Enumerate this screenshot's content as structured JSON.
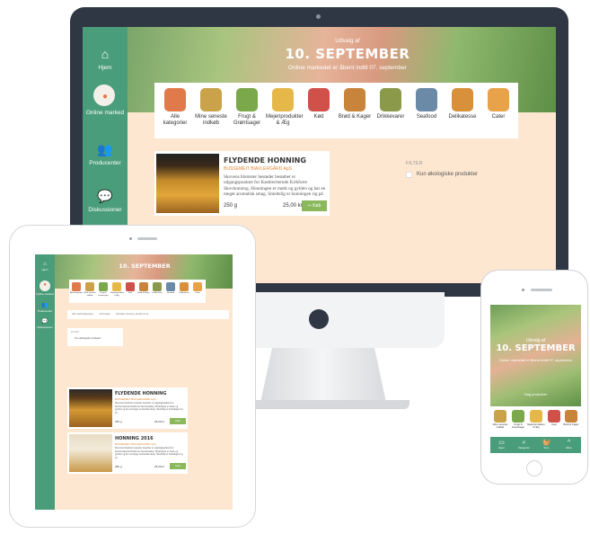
{
  "sidebar": [
    {
      "label": "Hjem",
      "icon": "home-icon",
      "glyph": "⌂"
    },
    {
      "label": "Online marked",
      "icon": "market-icon",
      "glyph": "●"
    },
    {
      "label": "Producenter",
      "icon": "people-icon",
      "glyph": "👥"
    },
    {
      "label": "Diskussioner",
      "icon": "chat-icon",
      "glyph": "💬"
    }
  ],
  "hero": {
    "subtitle": "Udvalg af",
    "date": "10. SEPTEMBER",
    "description": "Online markedet er åbent indtil 07. september"
  },
  "categories": [
    {
      "label": "Alle kategorier",
      "color": "#e07a4a"
    },
    {
      "label": "Mine seneste indkøb",
      "color": "#c9a24a"
    },
    {
      "label": "Frugt & Grøntsager",
      "color": "#7aa84a"
    },
    {
      "label": "Mejeriprodukter & Æg",
      "color": "#e6b84a"
    },
    {
      "label": "Kød",
      "color": "#d0504a"
    },
    {
      "label": "Brød & Kager",
      "color": "#c7843a"
    },
    {
      "label": "Drikkevarer",
      "color": "#8a9a4a"
    },
    {
      "label": "Seafood",
      "color": "#6a8aa8"
    },
    {
      "label": "Delikatesse",
      "color": "#d8903a"
    },
    {
      "label": "Cater",
      "color": "#e8a24a"
    }
  ],
  "product": {
    "title": "FLYDENDE HONNING",
    "subtitle": "BUSSEMEIT BIAVLERGÅRD ApS",
    "description": "Skovens blomster bestøder bestøber er udgangspunktet for Kastbechernde Kirkforte Skovhonning. Honningen er mørk og gylden og har en meget aromatisk smag. Smeltslig er honningen rig på",
    "weight": "250 g",
    "price": "25,00 kr.",
    "button": "Køb"
  },
  "filter": {
    "title": "FILTER",
    "option": "Kun økologiske produkter"
  },
  "tablet": {
    "breadcrumb": [
      "Alle markedsgrupper",
      "Honninget",
      "Nyheder, honning, lovede for ar"
    ],
    "filter_title": "FILTER",
    "filter_option": "Kun økologiske produkter",
    "products": [
      {
        "title": "FLYDENDE HONNING",
        "subtitle": "BUSSEMEIT BIAVLERGÅRD ApS",
        "description": "Skovens blomster bestøder bestøber er udgangspunktet for Kastbechernde Kirkforte Skovhonning. Honningen er mørk og gylden og har en meget aromatisk smag. Smeltslig er honningen rig på",
        "weight": "250 g",
        "price": "25,00 kr.",
        "button": "Køb",
        "image_colors": [
          "#2a2a2a",
          "#d49a34"
        ]
      },
      {
        "title": "HONNING 2016",
        "subtitle": "BUSSEMEIT BIAVLERGÅRD ApS",
        "description": "Skovens blomster bestøder bestøber er udgangspunktet for Kastbechernde Kirkforte Skovhonning. Honningen er mørk og gylden og har en meget aromatisk smag. Smeltslig er honningen rig på",
        "weight": "250 g",
        "price": "25,00 kr.",
        "button": "Køb",
        "image_colors": [
          "#e8dcc4",
          "#c89a4a"
        ]
      }
    ]
  },
  "phone": {
    "subtitle": "Udvalg af",
    "date": "10. SEPTEMBER",
    "description": "Online markedet er åbent indtil 07. september",
    "search": "Søg produkter",
    "categories": [
      {
        "label": "Mine seneste indkøb",
        "color": "#c9a24a"
      },
      {
        "label": "Frugt & Grøntsager",
        "color": "#7aa84a"
      },
      {
        "label": "Mejeriprodukter & Æg",
        "color": "#e6b84a"
      },
      {
        "label": "Kød",
        "color": "#d0504a"
      },
      {
        "label": "Brød & Kager",
        "color": "#c7843a"
      }
    ],
    "tabs": [
      {
        "label": "Hjem",
        "icon": "market-stall-icon",
        "glyph": "▭"
      },
      {
        "label": "Kategorier",
        "icon": "search-icon",
        "glyph": "⌕"
      },
      {
        "label": "Kurv",
        "icon": "basket-icon",
        "glyph": "🧺"
      },
      {
        "label": "Mere",
        "icon": "chevron-up-icon",
        "glyph": "^"
      }
    ]
  },
  "colors": {
    "brand_green": "#4a9d7a",
    "button_green": "#8ab85a",
    "page_peach": "#fde7d0",
    "accent_orange": "#e08a3a"
  }
}
